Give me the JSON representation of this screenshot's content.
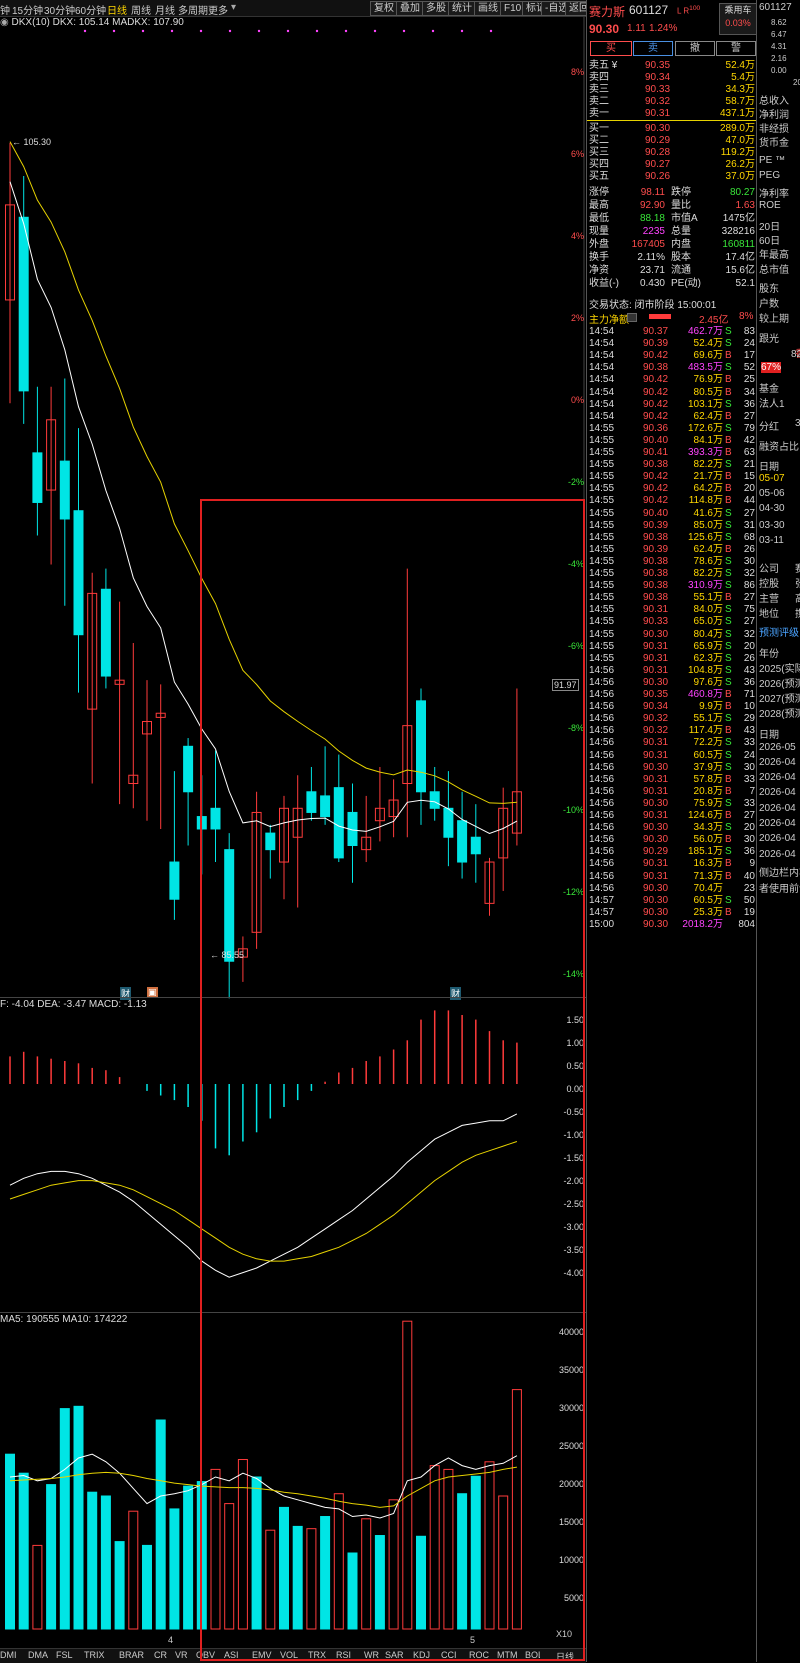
{
  "toolbar": {
    "periods": [
      "钟",
      "15分钟",
      "30分钟",
      "60分钟",
      "日线",
      "周线",
      "月线",
      "多周期",
      "更多"
    ],
    "active_period": "日线",
    "buttons": [
      "复权",
      "叠加",
      "多股",
      "统计",
      "画线",
      "F10",
      "标记",
      "-自选",
      "返回"
    ]
  },
  "chart": {
    "indicator_line": "DKX(10)  DKX: 105.14  MADKX: 107.90",
    "high_label": "105.30",
    "low_label": "85.55",
    "price_tag": "91.97",
    "pct_axis": [
      "8%",
      "6%",
      "4%",
      "2%",
      "0%",
      "-2%",
      "-4%",
      "-6%",
      "-8%",
      "-10%",
      "-12%",
      "-14%"
    ],
    "markers": [
      "财",
      "财",
      "财"
    ],
    "month_labels": [
      "4",
      "5"
    ]
  },
  "macd": {
    "legend": "F: -4.04  DEA: -3.47  MACD: -1.13",
    "axis": [
      "1.50",
      "1.00",
      "0.50",
      "0.00",
      "-0.50",
      "-1.00",
      "-1.50",
      "-2.00",
      "-2.50",
      "-3.00",
      "-3.50",
      "-4.00"
    ]
  },
  "volume": {
    "legend": "MA5: 190555  MA10: 174222",
    "axis": [
      "40000",
      "35000",
      "30000",
      "25000",
      "20000",
      "15000",
      "10000",
      "5000"
    ],
    "unit": "X10"
  },
  "bottom_tabs": [
    "DMI",
    "DMA",
    "FSL",
    "TRIX",
    "BRAR",
    "CR",
    "VR",
    "OBV",
    "ASI",
    "EMV",
    "VOL",
    "TRX",
    "RSI",
    "WR",
    "SAR",
    "KDJ",
    "CCI",
    "ROC",
    "MTM",
    "BOLL",
    "PSY",
    "MCST",
    "+",
    "指标"
  ],
  "bottom_right": "日线",
  "quote": {
    "name": "赛力斯",
    "code": "601127",
    "tag": "L R",
    "tag_sup": "100",
    "price": "90.30",
    "change": "1.11",
    "change_pct": "1.24%",
    "brand_line1": "乘用车",
    "brand_line2": "0.03%",
    "buttons": [
      "买",
      "卖",
      "撤",
      "警"
    ],
    "asks": [
      {
        "label": "卖五 ¥",
        "price": "90.35",
        "vol": "52.4万"
      },
      {
        "label": "卖四",
        "price": "90.34",
        "vol": "5.4万"
      },
      {
        "label": "卖三",
        "price": "90.33",
        "vol": "34.3万"
      },
      {
        "label": "卖二",
        "price": "90.32",
        "vol": "58.7万"
      },
      {
        "label": "卖一",
        "price": "90.31",
        "vol": "437.1万"
      }
    ],
    "bids": [
      {
        "label": "买一",
        "price": "90.30",
        "vol": "289.0万"
      },
      {
        "label": "买二",
        "price": "90.29",
        "vol": "47.0万"
      },
      {
        "label": "买三",
        "price": "90.28",
        "vol": "119.2万"
      },
      {
        "label": "买四",
        "price": "90.27",
        "vol": "26.2万"
      },
      {
        "label": "买五",
        "price": "90.26",
        "vol": "37.0万"
      }
    ],
    "stats": [
      [
        "涨停",
        "98.11",
        "跌停",
        "80.27"
      ],
      [
        "最高",
        "92.90",
        "量比",
        "1.63"
      ],
      [
        "最低",
        "88.18",
        "市值A",
        "1475亿"
      ],
      [
        "现量",
        "2235",
        "总量",
        "328216"
      ],
      [
        "外盘",
        "167405",
        "内盘",
        "160811"
      ],
      [
        "换手",
        "2.11%",
        "股本",
        "17.4亿"
      ],
      [
        "净资",
        "23.71",
        "流通",
        "15.6亿"
      ],
      [
        "收益(-)",
        "0.430",
        "PE(动)",
        "52.1"
      ]
    ],
    "trade_status": "交易状态: 闭市阶段 15:00:01",
    "net_inflow_label": "主力净额",
    "net_inflow_value": "2.45亿",
    "net_inflow_pct": "8%",
    "ticks": [
      [
        "14:54",
        "90.37",
        "462.7万",
        "S",
        "83"
      ],
      [
        "14:54",
        "90.39",
        "52.4万",
        "S",
        "24"
      ],
      [
        "14:54",
        "90.42",
        "69.6万",
        "B",
        "17"
      ],
      [
        "14:54",
        "90.38",
        "483.5万",
        "S",
        "52"
      ],
      [
        "14:54",
        "90.42",
        "76.9万",
        "B",
        "25"
      ],
      [
        "14:54",
        "90.42",
        "80.5万",
        "B",
        "34"
      ],
      [
        "14:54",
        "90.42",
        "103.1万",
        "S",
        "36"
      ],
      [
        "14:54",
        "90.42",
        "62.4万",
        "B",
        "27"
      ],
      [
        "14:55",
        "90.36",
        "172.6万",
        "S",
        "79"
      ],
      [
        "14:55",
        "90.40",
        "84.1万",
        "B",
        "42"
      ],
      [
        "14:55",
        "90.41",
        "393.3万",
        "B",
        "63"
      ],
      [
        "14:55",
        "90.38",
        "82.2万",
        "S",
        "21"
      ],
      [
        "14:55",
        "90.42",
        "21.7万",
        "B",
        "15"
      ],
      [
        "14:55",
        "90.42",
        "64.2万",
        "B",
        "20"
      ],
      [
        "14:55",
        "90.42",
        "114.8万",
        "B",
        "44"
      ],
      [
        "14:55",
        "90.40",
        "41.6万",
        "S",
        "27"
      ],
      [
        "14:55",
        "90.39",
        "85.0万",
        "S",
        "31"
      ],
      [
        "14:55",
        "90.38",
        "125.6万",
        "S",
        "68"
      ],
      [
        "14:55",
        "90.39",
        "62.4万",
        "B",
        "26"
      ],
      [
        "14:55",
        "90.38",
        "78.6万",
        "S",
        "30"
      ],
      [
        "14:55",
        "90.38",
        "82.2万",
        "S",
        "32"
      ],
      [
        "14:55",
        "90.38",
        "310.9万",
        "S",
        "86"
      ],
      [
        "14:55",
        "90.38",
        "55.1万",
        "B",
        "27"
      ],
      [
        "14:55",
        "90.31",
        "84.0万",
        "S",
        "75"
      ],
      [
        "14:55",
        "90.33",
        "65.0万",
        "S",
        "27"
      ],
      [
        "14:55",
        "90.30",
        "80.4万",
        "S",
        "32"
      ],
      [
        "14:55",
        "90.31",
        "65.9万",
        "S",
        "20"
      ],
      [
        "14:55",
        "90.31",
        "62.3万",
        "S",
        "26"
      ],
      [
        "14:56",
        "90.31",
        "104.8万",
        "S",
        "43"
      ],
      [
        "14:56",
        "90.30",
        "97.6万",
        "S",
        "36"
      ],
      [
        "14:56",
        "90.35",
        "460.8万",
        "B",
        "71"
      ],
      [
        "14:56",
        "90.34",
        "9.9万",
        "B",
        "10"
      ],
      [
        "14:56",
        "90.32",
        "55.1万",
        "S",
        "29"
      ],
      [
        "14:56",
        "90.32",
        "117.4万",
        "B",
        "43"
      ],
      [
        "14:56",
        "90.31",
        "72.2万",
        "S",
        "33"
      ],
      [
        "14:56",
        "90.31",
        "60.5万",
        "S",
        "24"
      ],
      [
        "14:56",
        "90.30",
        "37.9万",
        "S",
        "30"
      ],
      [
        "14:56",
        "90.31",
        "57.8万",
        "B",
        "33"
      ],
      [
        "14:56",
        "90.31",
        "20.8万",
        "B",
        "7"
      ],
      [
        "14:56",
        "90.30",
        "75.9万",
        "S",
        "33"
      ],
      [
        "14:56",
        "90.31",
        "124.6万",
        "B",
        "27"
      ],
      [
        "14:56",
        "90.30",
        "34.3万",
        "S",
        "20"
      ],
      [
        "14:56",
        "90.30",
        "56.0万",
        "B",
        "30"
      ],
      [
        "14:56",
        "90.29",
        "185.1万",
        "S",
        "36"
      ],
      [
        "14:56",
        "90.31",
        "16.3万",
        "B",
        "9"
      ],
      [
        "14:56",
        "90.31",
        "71.3万",
        "B",
        "40"
      ],
      [
        "14:56",
        "90.30",
        "70.4万",
        "",
        "23"
      ],
      [
        "14:57",
        "90.30",
        "60.5万",
        "S",
        "50"
      ],
      [
        "14:57",
        "90.30",
        "25.3万",
        "B",
        "19"
      ],
      [
        "15:00",
        "90.30",
        "2018.2万",
        "",
        "804"
      ]
    ]
  },
  "far_panel": {
    "code": "601127",
    "nums": [
      "8.62",
      "6.47",
      "4.31",
      "2.16",
      "0.00"
    ],
    "extra_num": "20",
    "items": [
      "总收入",
      "净利润",
      "非经损",
      "货币金",
      "PE ™",
      "PEG",
      "净利率",
      "ROE",
      "20日",
      "60日",
      "年最高",
      "总市值",
      "股东",
      "户数",
      "较上期",
      "跟光",
      "香多",
      "82人",
      "67%",
      "基金",
      "法人1",
      "分红",
      "32",
      "融资占比",
      "日期",
      "05-07",
      "05-06",
      "04-30",
      "03-30",
      "03-11",
      "公司",
      "控股",
      "主营",
      "地位",
      "赛力",
      "张兴",
      "高端",
      "携手",
      "预测评级",
      "年份",
      "2025(实际",
      "2026(预测",
      "2027(预测",
      "2028(预测",
      "日期",
      "2026-05",
      "2026-04",
      "2026-04",
      "2026-04",
      "2026-04",
      "2026-04",
      "2026-04",
      "2026-04",
      "侧边栏内容",
      "者使用前请"
    ]
  },
  "colors": {
    "up": "#ff3b3b",
    "down": "#00e5e5",
    "ma_white": "#ffffff",
    "ma_yellow": "#e6d200",
    "highlight": "#e02020"
  }
}
